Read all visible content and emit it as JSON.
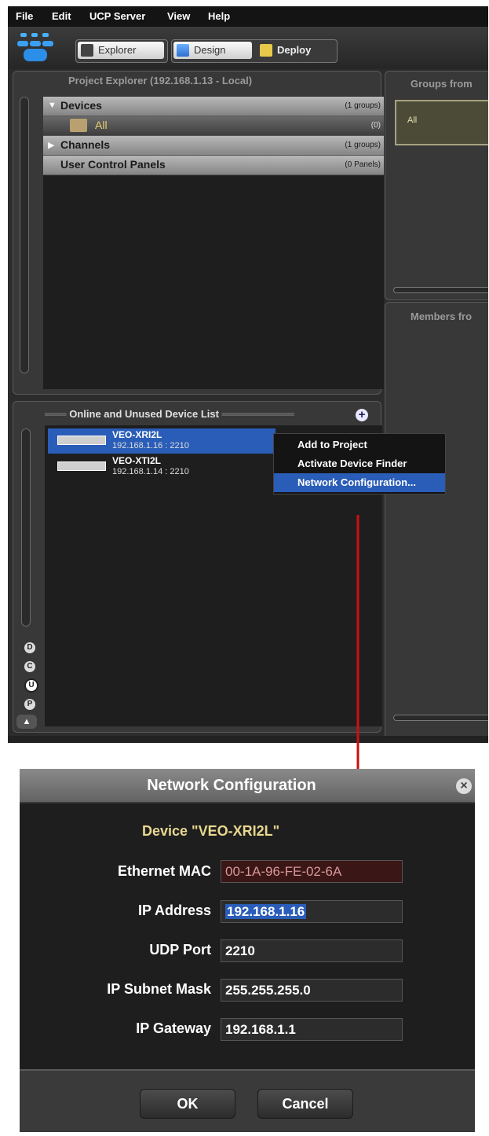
{
  "menu": [
    "File",
    "Edit",
    "UCP Server",
    "View",
    "Help"
  ],
  "toolbar": {
    "explorer": "Explorer",
    "design": "Design",
    "deploy": "Deploy"
  },
  "project_explorer": {
    "title": "Project Explorer (192.168.1.13 - Local)",
    "rows": [
      {
        "label": "Devices",
        "count": "(1 groups)"
      },
      {
        "label": "All",
        "count": "(0)"
      },
      {
        "label": "Channels",
        "count": "(1 groups)"
      },
      {
        "label": "User Control Panels",
        "count": "(0 Panels)"
      }
    ]
  },
  "groups_panel": {
    "title": "Groups from",
    "item": "All"
  },
  "members_panel": {
    "title": "Members fro"
  },
  "device_list": {
    "title": "Online and Unused Device List",
    "items": [
      {
        "name": "VEO-XRI2L",
        "address": "192.168.1.16 : 2210"
      },
      {
        "name": "VEO-XTI2L",
        "address": "192.168.1.14 : 2210"
      }
    ],
    "filters": [
      "D",
      "C",
      "U",
      "P"
    ]
  },
  "context_menu": [
    "Add to Project",
    "Activate Device Finder",
    "Network Configuration..."
  ],
  "dialog": {
    "title": "Network Configuration",
    "device": "Device \"VEO-XRI2L\"",
    "fields": [
      {
        "label": "Ethernet MAC",
        "value": "00-1A-96-FE-02-6A"
      },
      {
        "label": "IP Address",
        "value": "192.168.1.16"
      },
      {
        "label": "UDP Port",
        "value": "2210"
      },
      {
        "label": "IP Subnet Mask",
        "value": "255.255.255.0"
      },
      {
        "label": "IP Gateway",
        "value": "192.168.1.1"
      }
    ],
    "ok": "OK",
    "cancel": "Cancel"
  },
  "colors": {
    "selection": "#2a5db8",
    "device_label": "#e8d890",
    "mac_bg": "#3a1616",
    "arrow": "#cc1010"
  }
}
